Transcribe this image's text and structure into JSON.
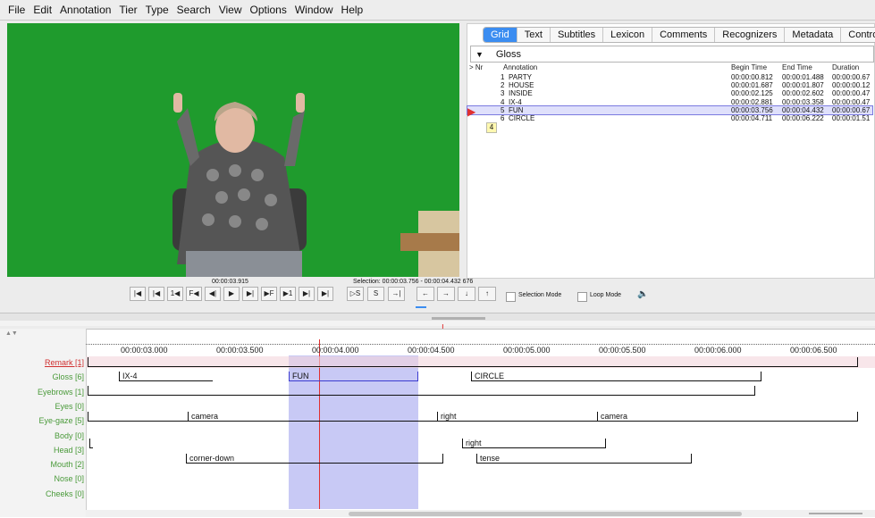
{
  "menu": [
    "File",
    "Edit",
    "Annotation",
    "Tier",
    "Type",
    "Search",
    "View",
    "Options",
    "Window",
    "Help"
  ],
  "tabs": [
    "Grid",
    "Text",
    "Subtitles",
    "Lexicon",
    "Comments",
    "Recognizers",
    "Metadata",
    "Controls"
  ],
  "active_tab": "Grid",
  "tier_selector": "Gloss",
  "grid": {
    "headers": {
      "nr": "> Nr",
      "annotation": "Annotation",
      "begin": "Begin Time",
      "end": "End Time",
      "duration": "Duration"
    },
    "rows": [
      {
        "nr": "1",
        "annotation": "PARTY",
        "begin": "00:00:00.812",
        "end": "00:00:01.488",
        "duration": "00:00:00.67"
      },
      {
        "nr": "2",
        "annotation": "HOUSE",
        "begin": "00:00:01.687",
        "end": "00:00:01.807",
        "duration": "00:00:00.12"
      },
      {
        "nr": "3",
        "annotation": "INSIDE",
        "begin": "00:00:02.125",
        "end": "00:00:02.602",
        "duration": "00:00:00.47"
      },
      {
        "nr": "4",
        "annotation": "IX-4",
        "begin": "00:00:02.881",
        "end": "00:00:03.358",
        "duration": "00:00:00.47"
      },
      {
        "nr": "5",
        "annotation": "FUN",
        "begin": "00:00:03.756",
        "end": "00:00:04.432",
        "duration": "00:00:00.67"
      },
      {
        "nr": "6",
        "annotation": "CIRCLE",
        "begin": "00:00:04.711",
        "end": "00:00:06.222",
        "duration": "00:00:01.51"
      }
    ],
    "tooltip_number": "4"
  },
  "media": {
    "current_time": "00:00:03.915",
    "selection": "Selection: 00:00:03.756 - 00:00:04.432  676",
    "buttons": [
      "|◀",
      "|◀",
      "1◀",
      "F◀",
      "◀|",
      "▶",
      "▶|",
      "▶F",
      "▶1",
      "▶|",
      "▶|"
    ],
    "sel_buttons": [
      "▷S",
      "S",
      "→|"
    ],
    "arrow_buttons": [
      "←",
      "→",
      "↓",
      "↑"
    ],
    "selection_mode": "Selection Mode",
    "loop_mode": "Loop Mode"
  },
  "timeline": {
    "ticks": [
      "00:00:03.000",
      "00:00:03.500",
      "00:00:04.000",
      "00:00:04.500",
      "00:00:05.000",
      "00:00:05.500",
      "00:00:06.000",
      "00:00:06.500"
    ],
    "tiers": [
      "Remark [1]",
      "Gloss [6]",
      "Eyebrows [1]",
      "Eyes [0]",
      "Eye-gaze [5]",
      "Body [0]",
      "Head [3]",
      "Mouth [2]",
      "Nose [0]",
      "Cheeks [0]"
    ],
    "annotations": {
      "gloss": [
        "IX-4",
        "FUN",
        "CIRCLE"
      ],
      "eyegaze": [
        "camera",
        "right",
        "camera"
      ],
      "head": [
        "right"
      ],
      "mouth": [
        "corner-down",
        "tense"
      ]
    }
  },
  "colors": {
    "accent": "#3b8df1",
    "selection": "#c8c9f5",
    "video_bg": "#1e9a2c",
    "crosshair": "#e03030"
  }
}
